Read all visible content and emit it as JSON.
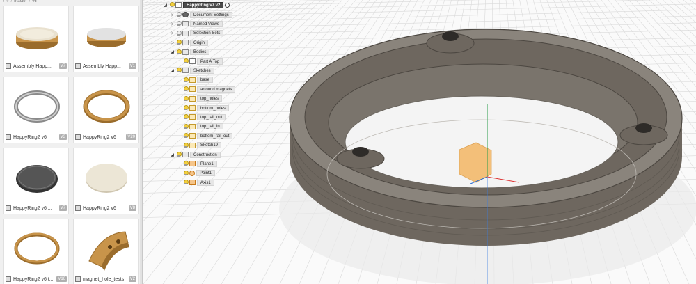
{
  "breadcrumb": [
    "master",
    "v6"
  ],
  "cards": [
    {
      "name": "Assembly Happ...",
      "version": "V7",
      "thumb": "flat-disc-gold"
    },
    {
      "name": "Assembly Happ...",
      "version": "V1",
      "thumb": "flat-disc-gold-light"
    },
    {
      "name": "HappyRing2 v6",
      "version": "V3",
      "thumb": "ring-gray"
    },
    {
      "name": "HappyRing2 v6",
      "version": "V20",
      "thumb": "ring-gold"
    },
    {
      "name": "HappyRing2 v6 ...",
      "version": "V7",
      "thumb": "dark-disc"
    },
    {
      "name": "HappyRing2 v6",
      "version": "V8",
      "thumb": "cream-disc"
    },
    {
      "name": "HappyRing2 v6 t...",
      "version": "V16",
      "thumb": "ring-gold-thin"
    },
    {
      "name": "magnet_hole_tests",
      "version": "V2",
      "thumb": "arc-block"
    }
  ],
  "tree": {
    "root": "HappyRing v7 v2",
    "items": [
      {
        "label": "Document Settings",
        "icon": "gear-icon",
        "caret": "right",
        "level": 1,
        "bulb": false
      },
      {
        "label": "Named Views",
        "icon": "folder-icon",
        "caret": "right",
        "level": 1,
        "bulb": false
      },
      {
        "label": "Selection Sets",
        "icon": "folder-icon",
        "caret": "right",
        "level": 1,
        "bulb": false
      },
      {
        "label": "Origin",
        "icon": "folder-icon",
        "caret": "right",
        "level": 1,
        "bulb": true
      },
      {
        "label": "Bodies",
        "icon": "folder-icon",
        "caret": "down",
        "level": 1,
        "bulb": true
      },
      {
        "label": "Part A Top",
        "icon": "body-icon",
        "caret": "",
        "level": 2,
        "bulb": true
      },
      {
        "label": "Sketches",
        "icon": "folder-icon",
        "caret": "down",
        "level": 1,
        "bulb": true
      },
      {
        "label": "base",
        "icon": "sketch-icon",
        "caret": "",
        "level": 2,
        "bulb": true
      },
      {
        "label": "arround magnets",
        "icon": "sketch-icon",
        "caret": "",
        "level": 2,
        "bulb": true
      },
      {
        "label": "top_holes",
        "icon": "sketch-icon",
        "caret": "",
        "level": 2,
        "bulb": true
      },
      {
        "label": "bottom_holes",
        "icon": "sketch-icon",
        "caret": "",
        "level": 2,
        "bulb": true
      },
      {
        "label": "top_rail_out",
        "icon": "sketch-icon",
        "caret": "",
        "level": 2,
        "bulb": true
      },
      {
        "label": "top_rail_in",
        "icon": "sketch-icon",
        "caret": "",
        "level": 2,
        "bulb": true
      },
      {
        "label": "bottom_rail_out",
        "icon": "sketch-icon",
        "caret": "",
        "level": 2,
        "bulb": true
      },
      {
        "label": "Sketch19",
        "icon": "sketch-icon",
        "caret": "",
        "level": 2,
        "bulb": true
      },
      {
        "label": "Construction",
        "icon": "folder-icon",
        "caret": "down",
        "level": 1,
        "bulb": true
      },
      {
        "label": "Plane1",
        "icon": "plane-icon",
        "caret": "",
        "level": 2,
        "bulb": true
      },
      {
        "label": "Point1",
        "icon": "point-icon",
        "caret": "",
        "level": 2,
        "bulb": true
      },
      {
        "label": "Axis1",
        "icon": "axis-icon",
        "caret": "",
        "level": 2,
        "bulb": true
      }
    ]
  },
  "colors": {
    "body": "#6e675f",
    "body_dark": "#4c4741",
    "body_light": "#8a847c",
    "gold": "#c8944a",
    "grid": "#d9d9d9",
    "plane": "#f3b25b"
  }
}
